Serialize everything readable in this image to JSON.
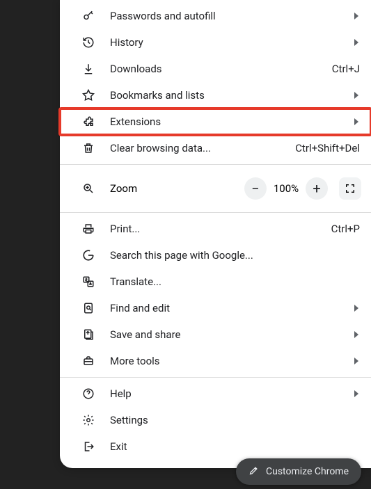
{
  "menu": {
    "groups": [
      [
        {
          "icon": "key",
          "label": "Passwords and autofill",
          "submenu": true
        },
        {
          "icon": "history",
          "label": "History",
          "submenu": true
        },
        {
          "icon": "download",
          "label": "Downloads",
          "shortcut": "Ctrl+J"
        },
        {
          "icon": "star",
          "label": "Bookmarks and lists",
          "submenu": true
        },
        {
          "icon": "extension",
          "label": "Extensions",
          "submenu": true,
          "highlight": true
        },
        {
          "icon": "trash",
          "label": "Clear browsing data...",
          "shortcut": "Ctrl+Shift+Del"
        }
      ],
      [
        {
          "icon": "zoom",
          "label": "Zoom",
          "zoom": true
        }
      ],
      [
        {
          "icon": "print",
          "label": "Print...",
          "shortcut": "Ctrl+P"
        },
        {
          "icon": "google",
          "label": "Search this page with Google..."
        },
        {
          "icon": "translate",
          "label": "Translate..."
        },
        {
          "icon": "find",
          "label": "Find and edit",
          "submenu": true
        },
        {
          "icon": "share",
          "label": "Save and share",
          "submenu": true
        },
        {
          "icon": "briefcase",
          "label": "More tools",
          "submenu": true
        }
      ],
      [
        {
          "icon": "help",
          "label": "Help",
          "submenu": true
        },
        {
          "icon": "settings",
          "label": "Settings"
        },
        {
          "icon": "exit",
          "label": "Exit"
        }
      ]
    ]
  },
  "zoom": {
    "level": "100%"
  },
  "customize": {
    "label": "Customize Chrome"
  }
}
